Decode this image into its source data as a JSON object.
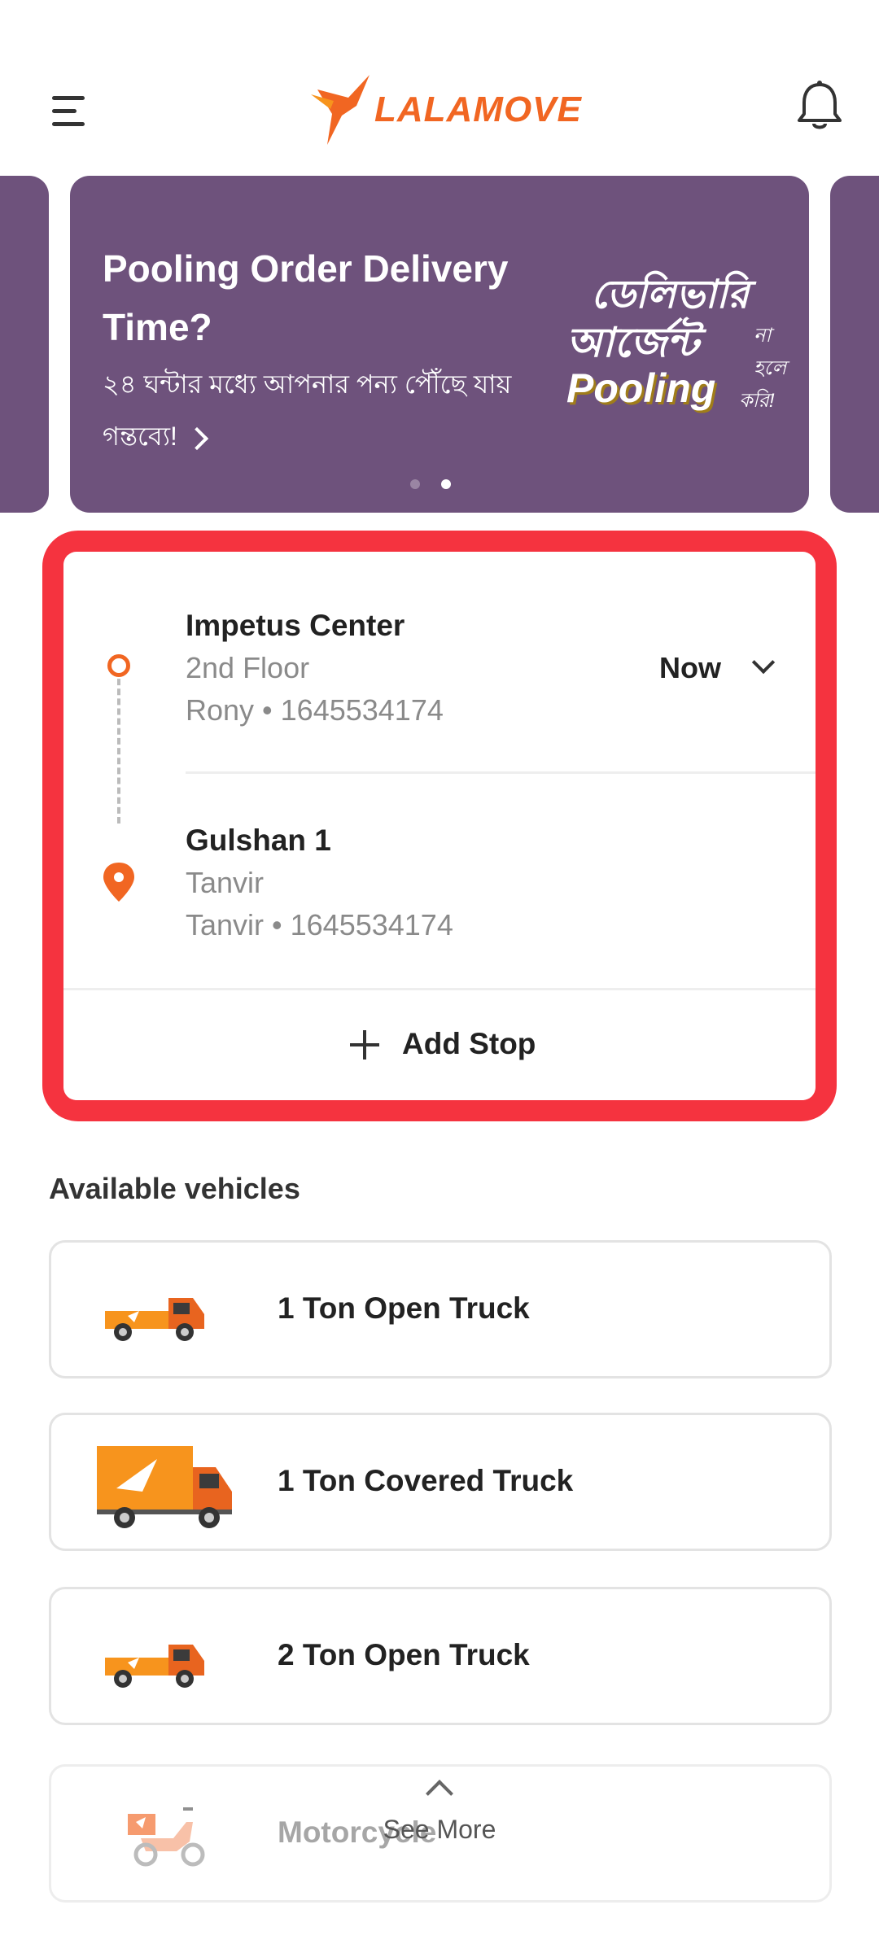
{
  "header": {
    "brand": "LALAMOVE",
    "brand_color": "#f16622"
  },
  "banner": {
    "title": "Pooling Order Delivery Time?",
    "subtitle": "২৪ ঘন্টার মধ্যে আপনার পন্য পৌঁছে যায় গন্তব্যে!",
    "promo": {
      "line1": "ডেলিভারি",
      "line2": "আর্জেন্ট",
      "na": "না হলে",
      "line3": "Pooling",
      "kori": "করি!"
    },
    "active_slide": 2,
    "slide_count": 2
  },
  "route": {
    "pickup": {
      "name": "Impetus Center",
      "detail": "2nd Floor",
      "contact": "Rony • 1645534174"
    },
    "dropoff": {
      "name": "Gulshan 1",
      "detail": "Tanvir",
      "contact": "Tanvir • 1645534174"
    },
    "time": "Now",
    "add_stop_label": "Add Stop"
  },
  "vehicles": {
    "title": "Available vehicles",
    "items": [
      {
        "name": "1 Ton Open Truck"
      },
      {
        "name": "1 Ton Covered Truck"
      },
      {
        "name": "2 Ton Open Truck"
      },
      {
        "name": "Motorcycle"
      }
    ],
    "see_more_label": "See More"
  },
  "colors": {
    "accent": "#f16622",
    "banner_bg": "#6e527c",
    "highlight_frame": "#f5333f"
  }
}
